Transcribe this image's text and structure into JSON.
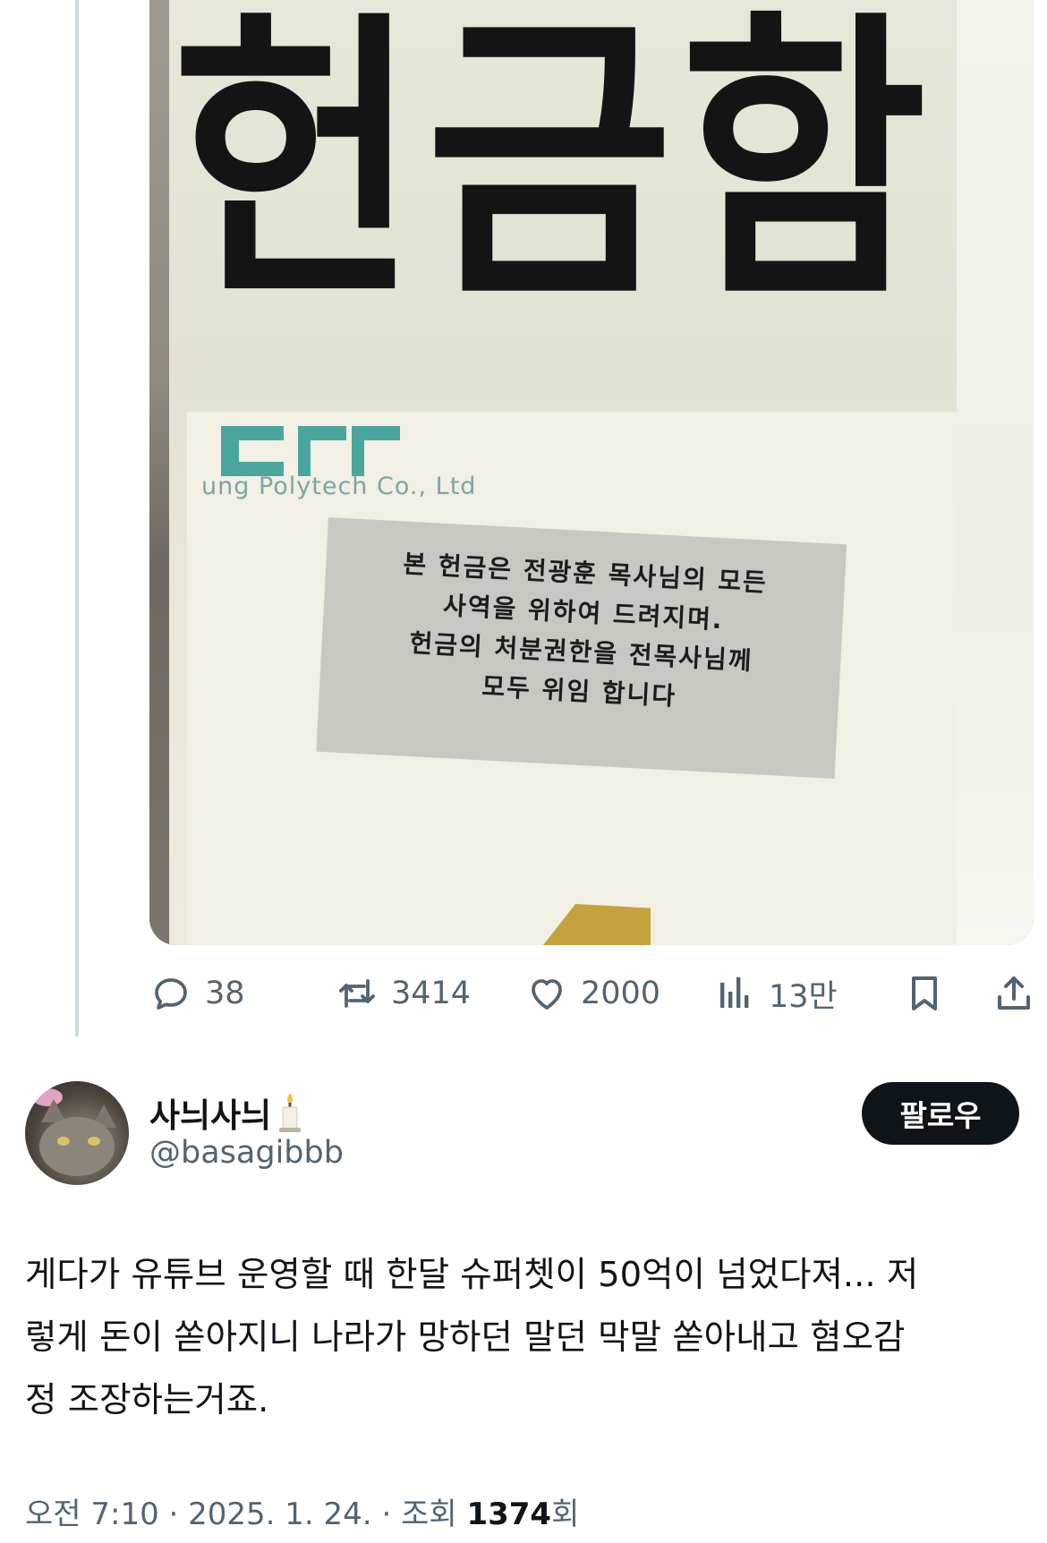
{
  "photo": {
    "sign_title": "헌금함",
    "brand_text": "ung Polytech Co., Ltd",
    "notice_lines": [
      "본 헌금은 전광훈 목사님의 모든",
      "사역을 위하여 드려지며.",
      "헌금의 처분권한을  전목사님께",
      "모두 위임 합니다"
    ]
  },
  "actions": {
    "reply_count": "38",
    "retweet_count": "3414",
    "like_count": "2000",
    "view_count": "13만"
  },
  "author": {
    "name": "사늬사늬",
    "handle": "@basagibbb",
    "follow_label": "팔로우"
  },
  "tweet": {
    "lines": [
      "게다가 유튜브 운영할 때 한달 슈퍼쳇이 50억이 넘었다져... 저",
      "렇게 돈이 쏟아지니 나라가 망하던 말던  막말 쏟아내고 혐오감",
      "정 조장하는거죠."
    ]
  },
  "meta": {
    "time": "오전 7:10",
    "date": "2025. 1. 24.",
    "views_label": "조회",
    "views_count": "1374",
    "views_suffix": "회"
  },
  "colors": {
    "text_primary": "#0f1419",
    "text_secondary": "#536471",
    "thread_line": "#cfd9de",
    "follow_button": "#0f1419"
  }
}
